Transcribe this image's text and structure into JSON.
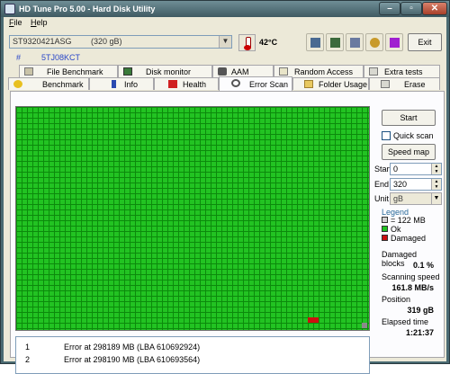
{
  "window": {
    "title": "HD Tune Pro 5.00 - Hard Disk Utility"
  },
  "menu": {
    "file": "File",
    "help": "Help"
  },
  "toolbar": {
    "drive_name": "ST9320421ASG",
    "drive_size": "(320 gB)",
    "temperature": "42°C",
    "exit_label": "Exit"
  },
  "drive_info": {
    "hash": "#",
    "serial": "5TJ08KCT"
  },
  "tabs_top": [
    {
      "label": "File Benchmark",
      "icon": "file-benchmark-icon"
    },
    {
      "label": "Disk monitor",
      "icon": "disk-monitor-icon"
    },
    {
      "label": "AAM",
      "icon": "speaker-icon"
    },
    {
      "label": "Random Access",
      "icon": "random-access-icon"
    },
    {
      "label": "Extra tests",
      "icon": "extra-tests-icon"
    }
  ],
  "tabs_bottom": [
    {
      "label": "Benchmark",
      "icon": "benchmark-icon"
    },
    {
      "label": "Info",
      "icon": "info-icon"
    },
    {
      "label": "Health",
      "icon": "health-cross-icon"
    },
    {
      "label": "Error Scan",
      "icon": "magnifier-icon",
      "active": true
    },
    {
      "label": "Folder Usage",
      "icon": "folder-icon"
    },
    {
      "label": "Erase",
      "icon": "erase-icon"
    }
  ],
  "scan": {
    "start_button": "Start",
    "quick_scan_label": "Quick scan",
    "quick_scan_checked": false,
    "speed_map_button": "Speed map",
    "start_label": "Start",
    "start_value": "0",
    "end_label": "End",
    "end_value": "320",
    "unit_label": "Unit",
    "unit_value": "gB"
  },
  "legend": {
    "title": "Legend",
    "items": [
      {
        "label": "= 122 MB",
        "color": "#d0d0d0"
      },
      {
        "label": "Ok",
        "color": "#22c322"
      },
      {
        "label": "Damaged",
        "color": "#cc1010"
      }
    ]
  },
  "stats": {
    "damaged_blocks_label": "Damaged blocks",
    "damaged_blocks_value": "0.1 %",
    "scanning_speed_label": "Scanning speed",
    "scanning_speed_value": "161.8 MB/s",
    "position_label": "Position",
    "position_value": "319 gB",
    "elapsed_label": "Elapsed time",
    "elapsed_value": "1:21:37"
  },
  "errors": [
    {
      "num": "1",
      "message": "Error at 298189 MB (LBA 610692924)"
    },
    {
      "num": "2",
      "message": "Error at 298190 MB (LBA 610693564)"
    }
  ],
  "colors": {
    "ok": "#22c322",
    "damaged": "#cc1010",
    "accent": "#2a47c8"
  }
}
